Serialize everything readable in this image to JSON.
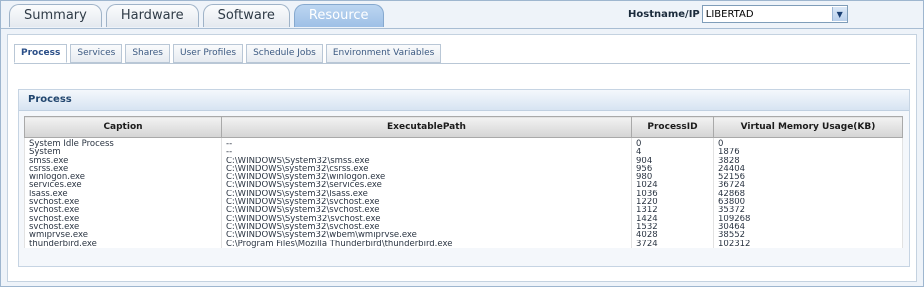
{
  "top_tabs": [
    {
      "label": "Summary",
      "active": false
    },
    {
      "label": "Hardware",
      "active": false
    },
    {
      "label": "Software",
      "active": false
    },
    {
      "label": "Resource",
      "active": true
    }
  ],
  "host": {
    "label": "Hostname/IP",
    "value": "LIBERTAD"
  },
  "sub_tabs": [
    {
      "label": "Process",
      "active": true
    },
    {
      "label": "Services",
      "active": false
    },
    {
      "label": "Shares",
      "active": false
    },
    {
      "label": "User Profiles",
      "active": false
    },
    {
      "label": "Schedule Jobs",
      "active": false
    },
    {
      "label": "Environment Variables",
      "active": false
    }
  ],
  "section": {
    "title": "Process"
  },
  "table": {
    "columns": [
      "Caption",
      "ExecutablePath",
      "ProcessID",
      "Virtual Memory Usage(KB)"
    ],
    "rows": [
      [
        "System Idle Process",
        "--",
        "0",
        "0"
      ],
      [
        "System",
        "--",
        "4",
        "1876"
      ],
      [
        "smss.exe",
        "C:\\WINDOWS\\System32\\smss.exe",
        "904",
        "3828"
      ],
      [
        "csrss.exe",
        "C:\\WINDOWS\\system32\\csrss.exe",
        "956",
        "24404"
      ],
      [
        "winlogon.exe",
        "C:\\WINDOWS\\system32\\winlogon.exe",
        "980",
        "52156"
      ],
      [
        "services.exe",
        "C:\\WINDOWS\\system32\\services.exe",
        "1024",
        "36724"
      ],
      [
        "lsass.exe",
        "C:\\WINDOWS\\system32\\lsass.exe",
        "1036",
        "42868"
      ],
      [
        "svchost.exe",
        "C:\\WINDOWS\\system32\\svchost.exe",
        "1220",
        "63800"
      ],
      [
        "svchost.exe",
        "C:\\WINDOWS\\system32\\svchost.exe",
        "1312",
        "35372"
      ],
      [
        "svchost.exe",
        "C:\\WINDOWS\\System32\\svchost.exe",
        "1424",
        "109268"
      ],
      [
        "svchost.exe",
        "C:\\WINDOWS\\system32\\svchost.exe",
        "1532",
        "30464"
      ],
      [
        "wmiprvse.exe",
        "C:\\WINDOWS\\system32\\wbem\\wmiprvse.exe",
        "4028",
        "38552"
      ],
      [
        "thunderbird.exe",
        "C:\\Program Files\\Mozilla Thunderbird\\thunderbird.exe",
        "3724",
        "102312"
      ]
    ]
  },
  "colors": {
    "accent": "#9ec0e6",
    "header_text": "#22466f"
  }
}
